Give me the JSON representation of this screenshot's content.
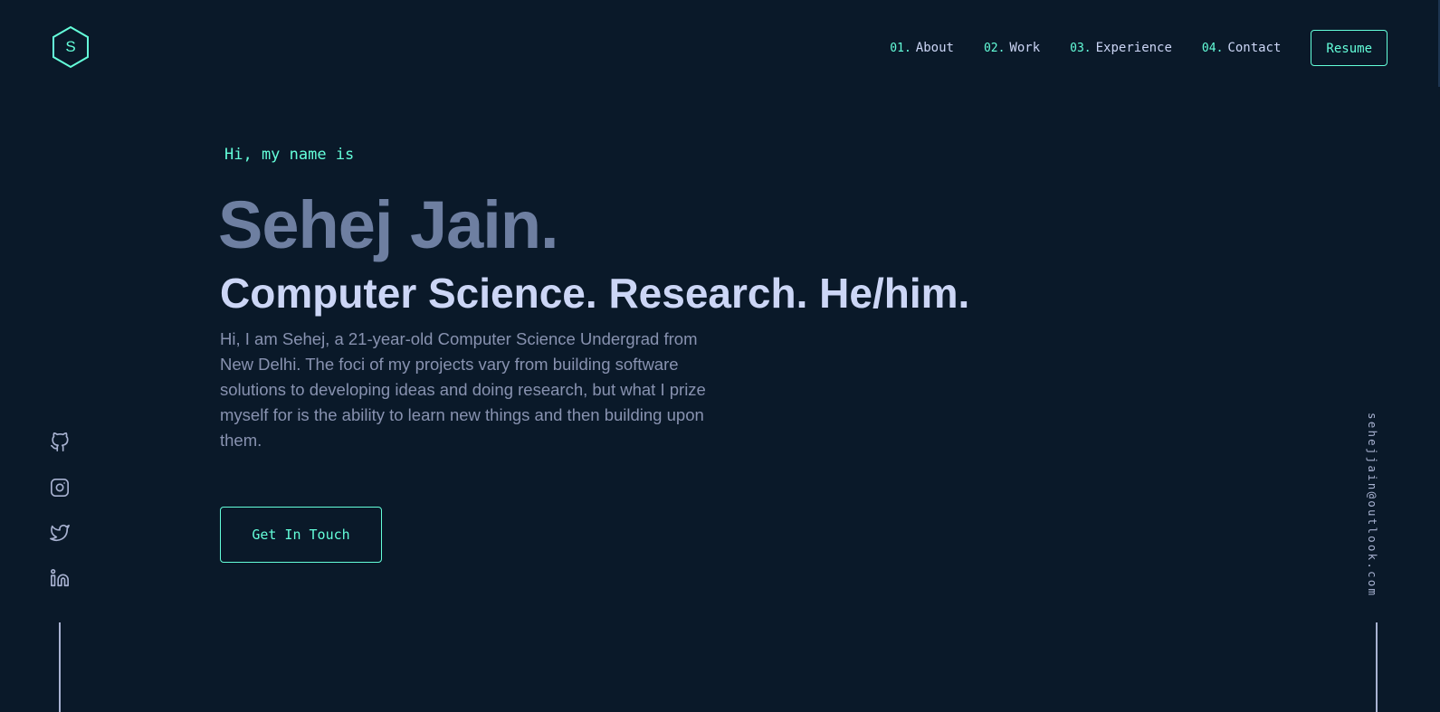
{
  "brand": {
    "logo_letter": "S",
    "accent_color": "#64ffda",
    "background_color": "#0a1929"
  },
  "nav": {
    "items": [
      {
        "num": "01.",
        "label": "About"
      },
      {
        "num": "02.",
        "label": "Work"
      },
      {
        "num": "03.",
        "label": "Experience"
      },
      {
        "num": "04.",
        "label": "Contact"
      }
    ],
    "resume_label": "Resume"
  },
  "hero": {
    "greeting": "Hi, my name is",
    "name": "Sehej Jain.",
    "tagline": "Computer Science. Research. He/him.",
    "bio": "Hi, I am Sehej, a 21-year-old Computer Science Undergrad from New Delhi. The foci of my projects vary from building software solutions to developing ideas and doing research, but what I prize myself for is the ability to learn new things and then building upon them.",
    "cta_label": "Get In Touch"
  },
  "social": {
    "icons": [
      "github-icon",
      "instagram-icon",
      "twitter-icon",
      "linkedin-icon"
    ]
  },
  "email": "sehejjain@outlook.com"
}
